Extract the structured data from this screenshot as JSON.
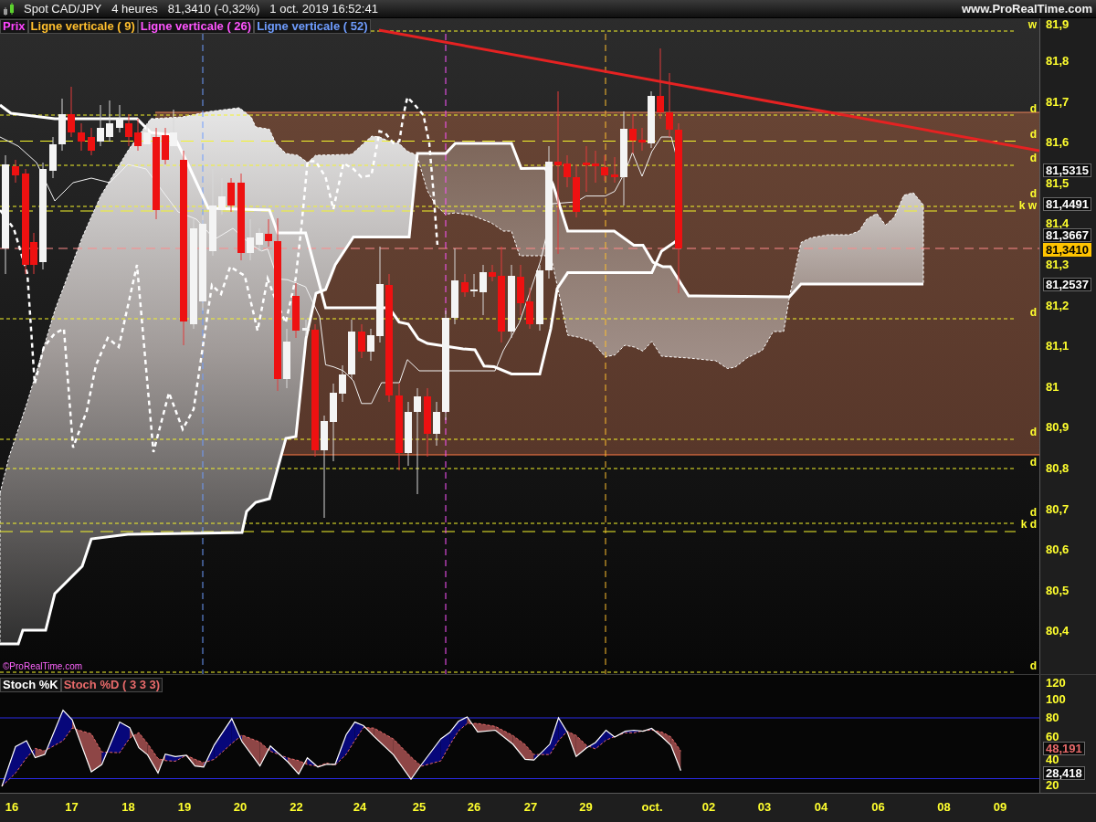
{
  "header": {
    "instrument": "Spot CAD/JPY",
    "timeframe": "4 heures",
    "quote": "81,3410 (-0,32%)",
    "datetime": "1 oct. 2019 16:52:41",
    "website": "www.ProRealTime.com"
  },
  "price_panel": {
    "legend": [
      {
        "label": "Prix",
        "color": "#ff44ff"
      },
      {
        "label": "Ligne verticale ( 9)",
        "color": "#ffbf2e"
      },
      {
        "label": "Ligne verticale ( 26)",
        "color": "#ff55ff"
      },
      {
        "label": "Ligne verticale ( 52)",
        "color": "#6f9dff"
      }
    ],
    "level_tags": [
      "w",
      "d",
      "d",
      "d",
      "d",
      "k w",
      "d",
      "d",
      "d",
      "d",
      "k d",
      "d"
    ],
    "axis_labels": [
      "81,9",
      "81,8",
      "81,7",
      "81,6",
      "81,5",
      "81,4",
      "81,3",
      "81,2",
      "81,1",
      "81",
      "80,9",
      "80,8",
      "80,7",
      "80,6",
      "80,5",
      "80,4"
    ],
    "price_markers": [
      {
        "text": "81,5315",
        "kind": "marker"
      },
      {
        "text": "81,4491",
        "kind": "marker"
      },
      {
        "text": "81,3667",
        "kind": "marker"
      },
      {
        "text": "81,3410",
        "kind": "current"
      },
      {
        "text": "81,2537",
        "kind": "marker"
      }
    ],
    "copyright": "©ProRealTime.com"
  },
  "stochastic_panel": {
    "legend": [
      {
        "label": "Stoch %K",
        "color": "#ffffff"
      },
      {
        "label": "Stoch %D ( 3 3 3)",
        "color": "#e86a6a"
      }
    ],
    "axis_labels": [
      "120",
      "100",
      "80",
      "60",
      "40",
      "20"
    ],
    "value_markers": [
      {
        "text": "48,191",
        "color": "#e86a6a"
      },
      {
        "text": "28,418",
        "color": "#ffffff"
      }
    ]
  },
  "date_axis": [
    "16",
    "17",
    "18",
    "19",
    "20",
    "22",
    "24",
    "25",
    "26",
    "27",
    "29",
    "oct.",
    "02",
    "03",
    "04",
    "06",
    "08",
    "09"
  ]
}
